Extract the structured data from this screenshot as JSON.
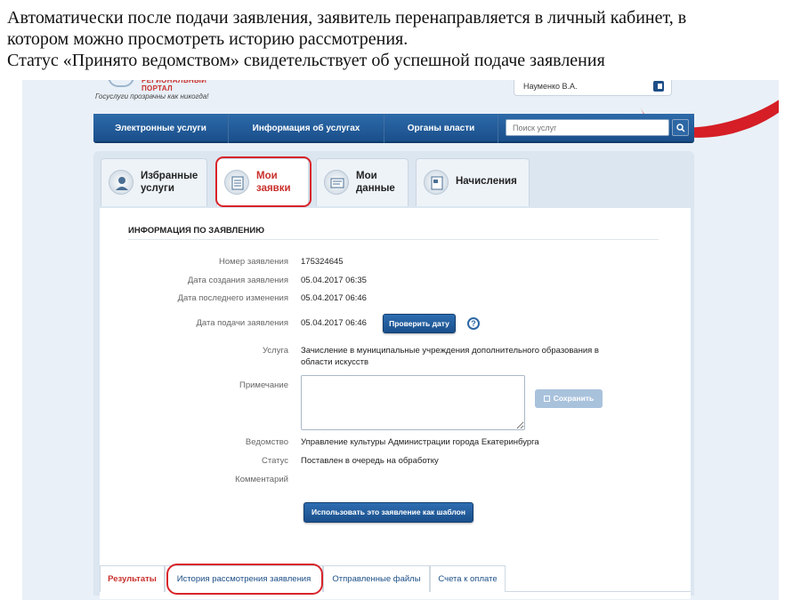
{
  "slide": {
    "line1": "Автоматически после подачи заявления, заявитель перенаправляется в личный кабинет, в",
    "line2": "котором можно просмотреть историю рассмотрения.",
    "line3": "Статус «Принято ведомством» свидетельствует об успешной подаче заявления"
  },
  "header": {
    "logo_text": "РЕГИОНАЛЬНЫЙ ПОРТАЛ",
    "slogan": "Госуслуги прозрачны как никогда!",
    "user_name": "Науменко В.А."
  },
  "nav": {
    "items": [
      "Электронные услуги",
      "Информация об услугах",
      "Органы власти"
    ],
    "search_placeholder": "Поиск услуг",
    "search_icon": "search-icon"
  },
  "tabs": [
    {
      "label": "Избранные\nуслуги",
      "icon": "user-icon",
      "active": false
    },
    {
      "label": "Мои\nзаявки",
      "icon": "list-icon",
      "active": true
    },
    {
      "label": "Мои\nданные",
      "icon": "id-card-icon",
      "active": false
    },
    {
      "label": "Начисления",
      "icon": "document-icon",
      "active": false
    }
  ],
  "application": {
    "section_title": "ИНФОРМАЦИЯ ПО ЗАЯВЛЕНИЮ",
    "fields": {
      "number_label": "Номер заявления",
      "number_value": "175324645",
      "created_label": "Дата создания заявления",
      "created_value": "05.04.2017 06:35",
      "modified_label": "Дата последнего изменения",
      "modified_value": "05.04.2017 06:46",
      "submitted_label": "Дата подачи заявления",
      "submitted_value": "05.04.2017 06:46",
      "service_label": "Услуга",
      "service_value": "Зачисление в муниципальные учреждения дополнительного образования в области искусств",
      "note_label": "Примечание",
      "note_value": "",
      "department_label": "Ведомство",
      "department_value": "Управление культуры Администрации города Екатеринбурга",
      "status_label": "Статус",
      "status_value": "Поставлен в очередь на обработку",
      "comment_label": "Комментарий"
    },
    "check_date_button": "Проверить дату",
    "save_button": "Сохранить",
    "template_button": "Использовать это заявление как шаблон"
  },
  "bottom_tabs": [
    "Результаты",
    "История рассмотрения заявления",
    "Отправленные файлы",
    "Счета к оплате"
  ],
  "colors": {
    "brand_blue": "#1a4f8b",
    "highlight_red": "#d8232a",
    "active_tab_red": "#c9302c"
  }
}
